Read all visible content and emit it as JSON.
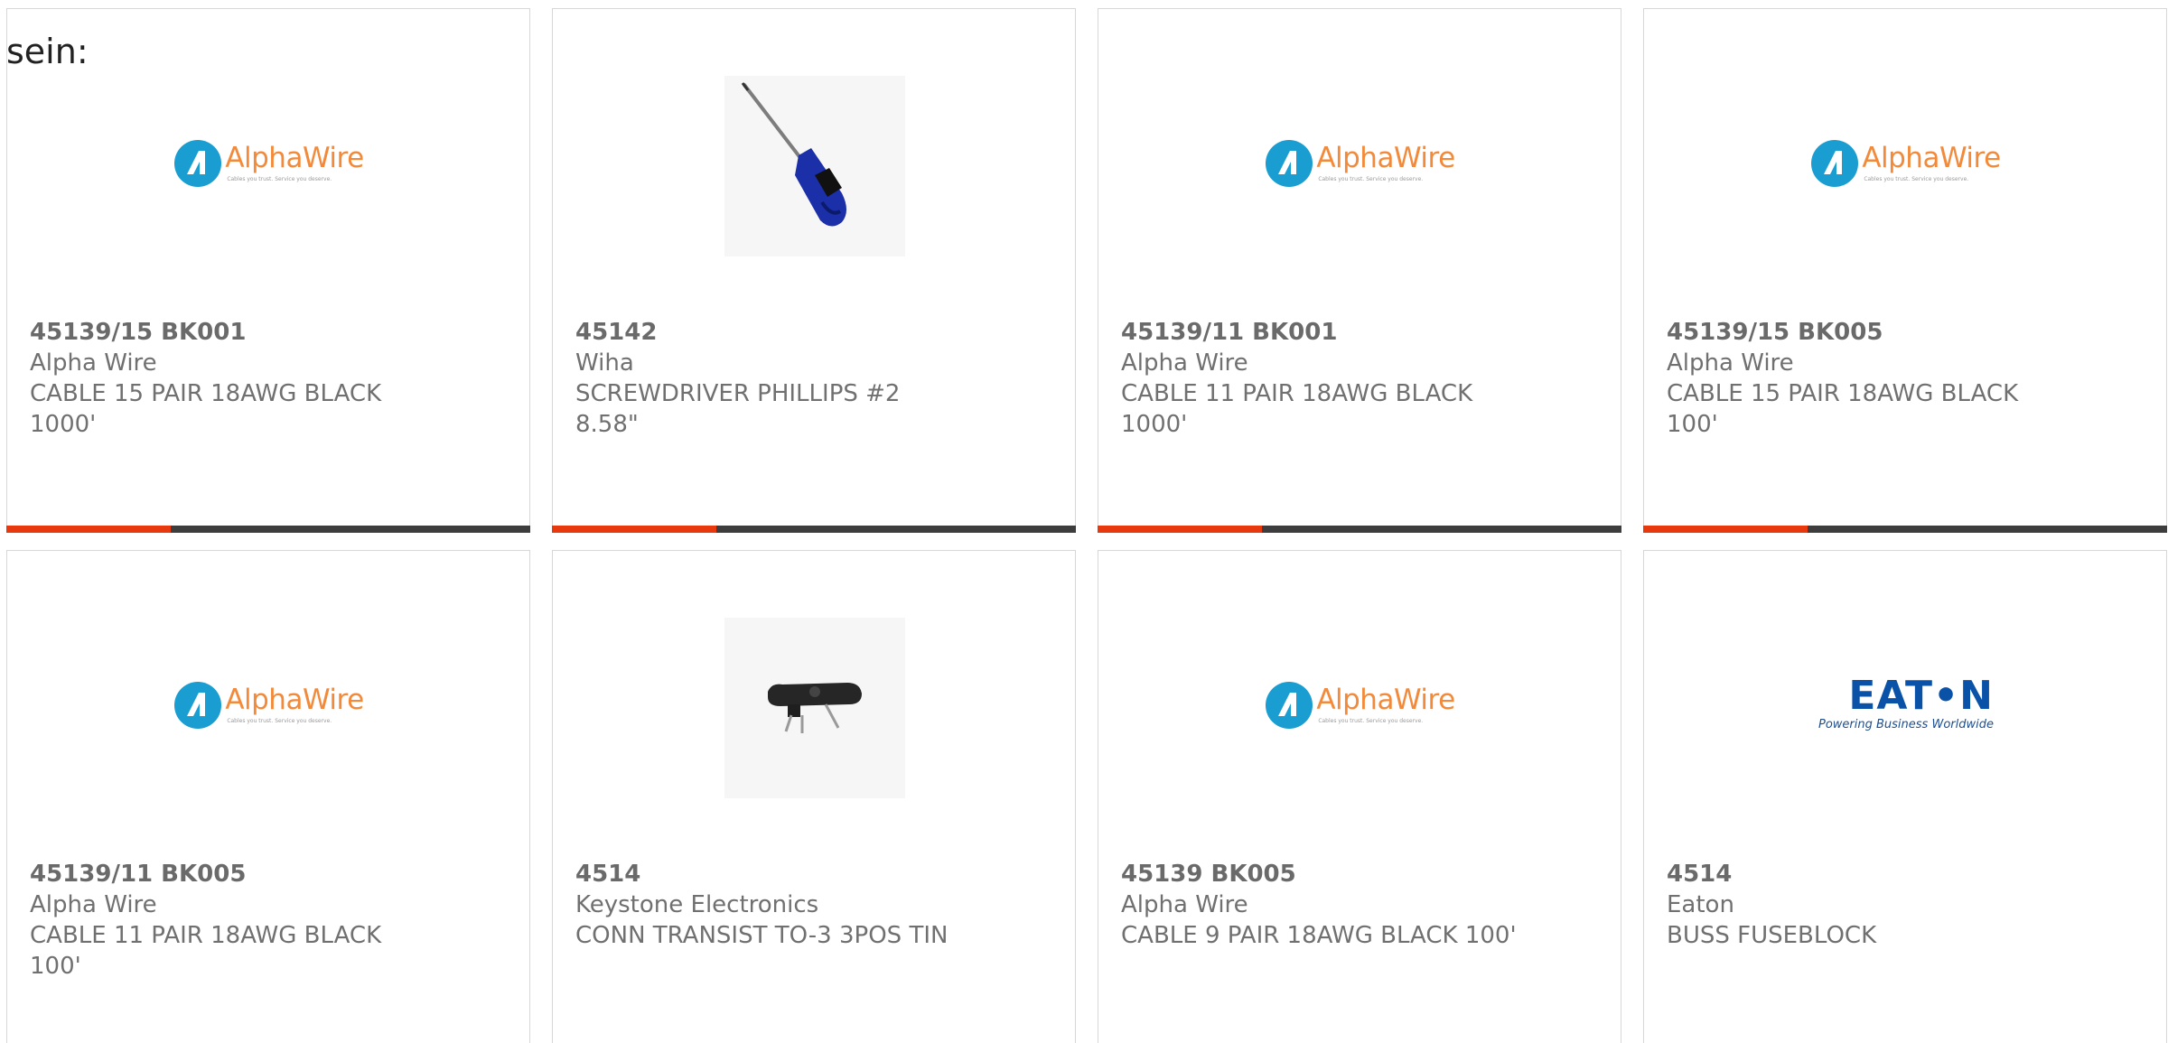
{
  "intro_text": "sein:",
  "colors": {
    "accent": "#e8380d",
    "bar": "#3d3d3d",
    "text": "#707070",
    "border": "#d7d7d7"
  },
  "logos": {
    "alphawire_name": "AlphaWire",
    "alphawire_tag": "Cables you trust. Service you deserve.",
    "eaton_name": "EAT•N",
    "eaton_tag": "Powering Business Worldwide"
  },
  "products": [
    {
      "part_number": "45139/15 BK001",
      "manufacturer": "Alpha Wire",
      "description": "CABLE 15 PAIR 18AWG BLACK 1000'",
      "image": "alphawire-logo"
    },
    {
      "part_number": "45142",
      "manufacturer": "Wiha",
      "description": "SCREWDRIVER PHILLIPS #2 8.58\"",
      "image": "screwdriver-photo"
    },
    {
      "part_number": "45139/11 BK001",
      "manufacturer": "Alpha Wire",
      "description": "CABLE 11 PAIR 18AWG BLACK 1000'",
      "image": "alphawire-logo"
    },
    {
      "part_number": "45139/15 BK005",
      "manufacturer": "Alpha Wire",
      "description": "CABLE 15 PAIR 18AWG BLACK 100'",
      "image": "alphawire-logo"
    },
    {
      "part_number": "45139/11 BK005",
      "manufacturer": "Alpha Wire",
      "description": "CABLE 11 PAIR 18AWG BLACK 100'",
      "image": "alphawire-logo"
    },
    {
      "part_number": "4514",
      "manufacturer": "Keystone Electronics",
      "description": "CONN TRANSIST TO-3 3POS TIN",
      "image": "connector-photo"
    },
    {
      "part_number": "45139 BK005",
      "manufacturer": "Alpha Wire",
      "description": "CABLE 9 PAIR 18AWG BLACK 100'",
      "image": "alphawire-logo"
    },
    {
      "part_number": "4514",
      "manufacturer": "Eaton",
      "description": "BUSS FUSEBLOCK",
      "image": "eaton-logo"
    }
  ]
}
